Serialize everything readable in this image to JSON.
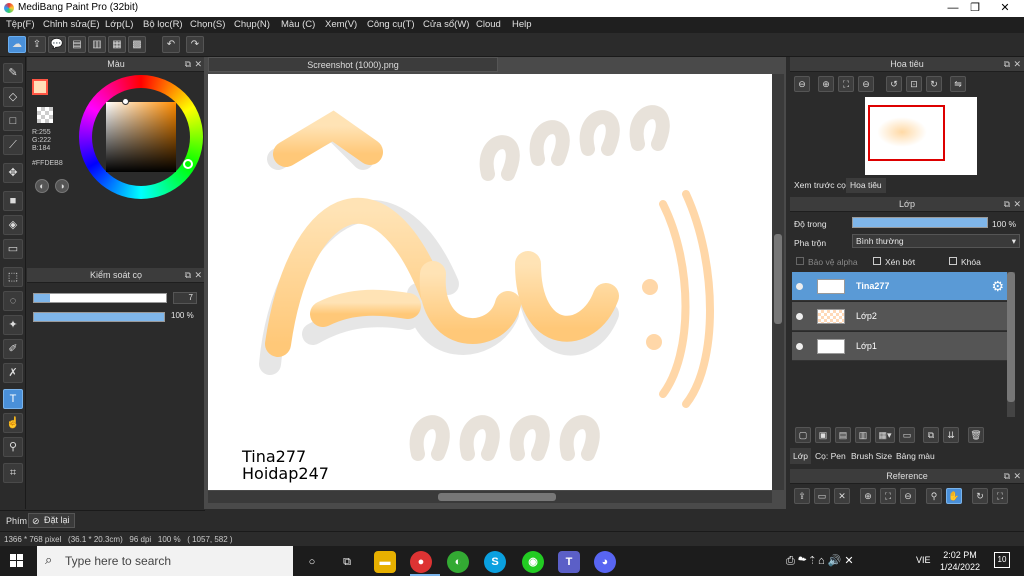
{
  "window": {
    "title": "MediBang Paint Pro (32bit)",
    "minimize": "—",
    "maximize": "❐",
    "close": "✕"
  },
  "menu": [
    "Tệp(F)",
    "Chỉnh sửa(E)",
    "Lớp(L)",
    "Bộ lọc(R)",
    "Chọn(S)",
    "Chụp(N)",
    "Màu (C)",
    "Xem(V)",
    "Công cụ(T)",
    "Cửa sổ(W)",
    "Cloud",
    "Help"
  ],
  "color_panel": {
    "title": "Màu",
    "r": "R:255",
    "g": "G:222",
    "b": "B:184",
    "hex": "#FFDEB8",
    "primary_color": "#FFDEB8",
    "accent_color": "#FF5544"
  },
  "brush_panel": {
    "title": "Kiểm soát cọ",
    "size": "7",
    "opacity": "100 %"
  },
  "document": {
    "tab": "Screenshot (1000).png"
  },
  "canvas_text": {
    "line1": "Tina277",
    "line2": "Hoidap247",
    "art": "Âu:))",
    "deco_top": "ɞɞɞɞ",
    "deco_bottom": "ɞɞɞɞ"
  },
  "navigator": {
    "title": "Hoa tiêu",
    "tab_preview": "Xem trước cọ",
    "tab_nav": "Hoa tiêu"
  },
  "layers": {
    "title": "Lớp",
    "opacity_label": "Độ trong",
    "opacity_value": "100 %",
    "blend_label": "Pha trộn",
    "blend_value": "Bình thường",
    "protect_alpha": "Bảo vệ alpha",
    "clipping": "Xén bớt",
    "lock": "Khóa",
    "items": [
      {
        "name": "Tina277"
      },
      {
        "name": "Lớp2"
      },
      {
        "name": "Lớp1"
      }
    ]
  },
  "bottom_tabs": [
    "Lớp",
    "Cọ: Pen",
    "Brush Size",
    "Bảng màu"
  ],
  "reference": {
    "title": "Reference"
  },
  "left_bottom": {
    "tab": "Phím",
    "reset": "Đặt lại"
  },
  "status": {
    "text": "1366 * 768 pixel   (36.1 * 20.3cm)   96 dpi   100 %   ( 1057, 582 )"
  },
  "taskbar": {
    "search_placeholder": "Type here to search",
    "lang": "VIE",
    "time": "2:02 PM",
    "date": "1/24/2022",
    "notif": "10"
  }
}
